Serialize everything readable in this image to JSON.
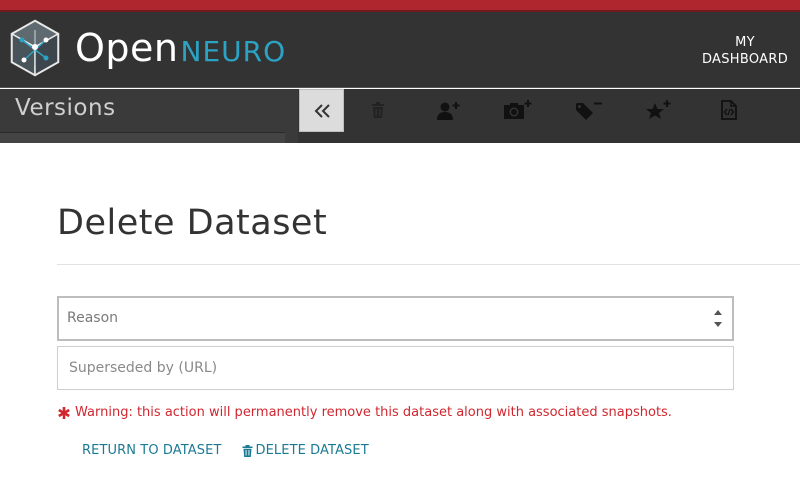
{
  "header": {
    "brand_primary": "Open",
    "brand_secondary": "NEURO",
    "dashboard_link": "MY\nDASHBOARD",
    "accent_color": "#b0262f",
    "brand_color": "#2ba3c4",
    "nav_bg": "#333333"
  },
  "sidebar": {
    "title": "Versions"
  },
  "toolbar": {
    "collapse_icon": "double-chevron-left-icon",
    "tools": [
      {
        "name": "trash-icon"
      },
      {
        "name": "add-user-icon"
      },
      {
        "name": "add-snapshot-icon"
      },
      {
        "name": "remove-tag-icon"
      },
      {
        "name": "add-star-icon"
      },
      {
        "name": "code-file-icon"
      }
    ]
  },
  "main": {
    "title": "Delete Dataset",
    "reason_select": {
      "value": "Reason",
      "options": [
        "Reason"
      ]
    },
    "superseded_input": {
      "placeholder": "Superseded by (URL)",
      "value": ""
    },
    "warning": "Warning: this action will permanently remove this dataset along with associated snapshots.",
    "warning_color": "#d0272f",
    "return_link": "RETURN TO DATASET",
    "delete_link": "DELETE DATASET",
    "link_color": "#1b7a93"
  }
}
